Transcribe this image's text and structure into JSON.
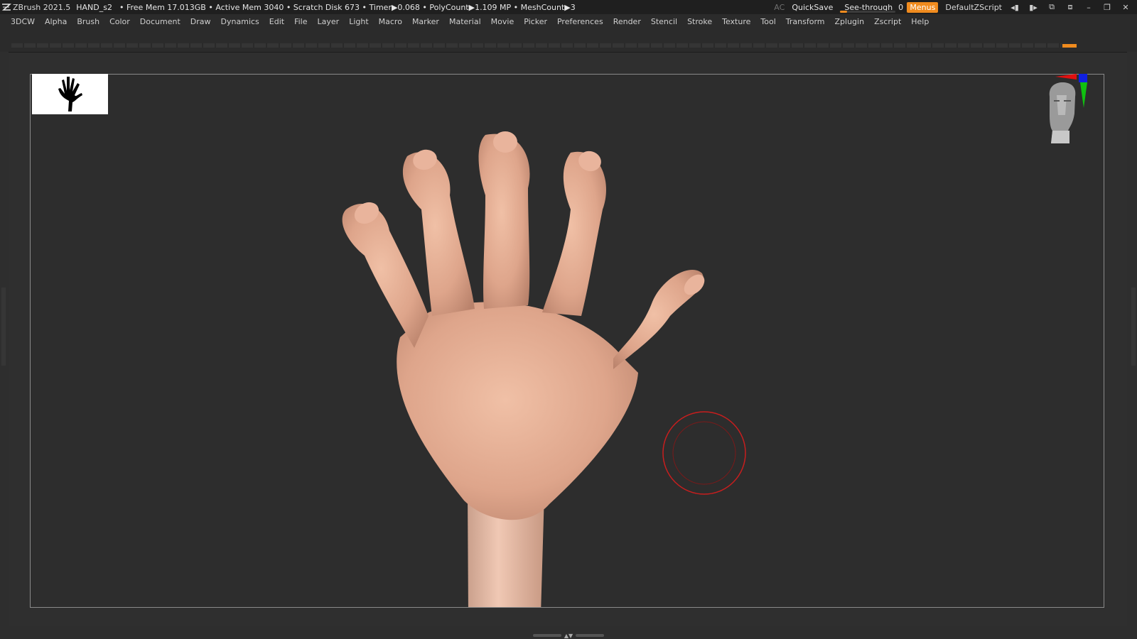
{
  "titlebar": {
    "app": "ZBrush 2021.5",
    "document": "HAND_s2",
    "status": "• Free Mem 17.013GB • Active Mem 3040 • Scratch Disk 673 •  Timer▶0.068 • PolyCount▶1.109 MP  • MeshCount▶3",
    "ac_label": "AC",
    "quicksave_label": "QuickSave",
    "seethrough_label": "See-through",
    "seethrough_value": "0",
    "seethrough_fraction": 0.12,
    "menus_label": "Menus",
    "script_label": "DefaultZScript"
  },
  "menu": {
    "items": [
      "3DCW",
      "Alpha",
      "Brush",
      "Color",
      "Document",
      "Draw",
      "Dynamics",
      "Edit",
      "File",
      "Layer",
      "Light",
      "Macro",
      "Marker",
      "Material",
      "Movie",
      "Picker",
      "Preferences",
      "Render",
      "Stencil",
      "Stroke",
      "Texture",
      "Tool",
      "Transform",
      "Zplugin",
      "Zscript",
      "Help"
    ]
  },
  "icons": {
    "app_logo": "zbrush-logo-icon",
    "thumbnail": "hand-silhouette-icon",
    "nav": "head-navigation-icon",
    "brush_cursor": "brush-cursor-icon"
  },
  "colors": {
    "accent": "#f08b1e",
    "skin": "#e0a88d",
    "cursor": "#c81e1e"
  }
}
